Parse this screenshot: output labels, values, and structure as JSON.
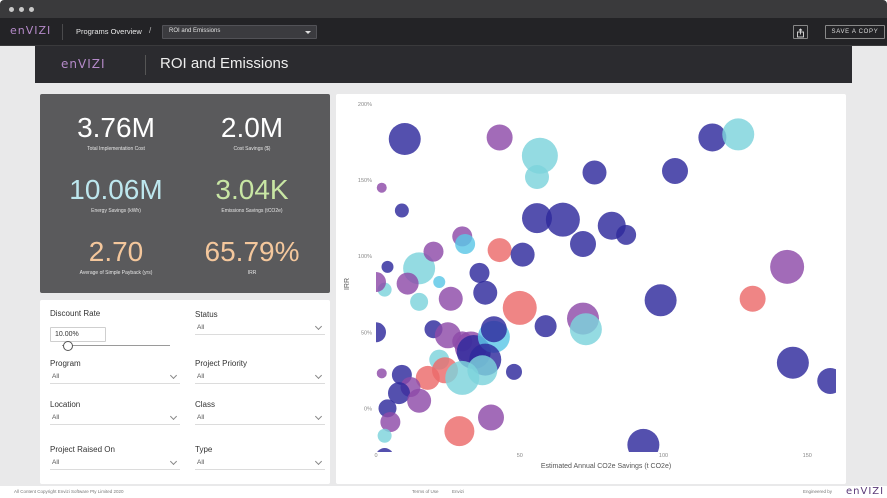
{
  "window": {
    "dots": [
      "",
      "",
      ""
    ]
  },
  "appbar": {
    "logo": "enVIZI",
    "breadcrumb": "Programs Overview",
    "breadcrumb_separator": "/",
    "report_select": "ROI and Emissions",
    "share_icon": "share-icon",
    "save_copy_label": "SAVE A COPY"
  },
  "hero": {
    "logo": "enVIZI",
    "title": "ROI and Emissions"
  },
  "kpis": [
    {
      "value": "3.76M",
      "label": "Total Implementation Cost",
      "color": "#ffffff"
    },
    {
      "value": "2.0M",
      "label": "Cost Savings ($)",
      "color": "#ffffff"
    },
    {
      "value": "10.06M",
      "label": "Energy Savings (kWh)",
      "color": "#bde7ee"
    },
    {
      "value": "3.04K",
      "label": "Emissions Savings (tCO2e)",
      "color": "#c8e6a4"
    },
    {
      "value": "2.70",
      "label": "Average of Simple Payback (yrs)",
      "color": "#f4c79c"
    },
    {
      "value": "65.79%",
      "label": "IRR",
      "color": "#f4c79c"
    }
  ],
  "filters": {
    "discount_rate": {
      "label": "Discount Rate",
      "value": "10.00%",
      "slider_fraction": 0.05
    },
    "status": {
      "label": "Status",
      "value": "All"
    },
    "program": {
      "label": "Program",
      "value": "All"
    },
    "project_priority": {
      "label": "Project Priority",
      "value": "All"
    },
    "location": {
      "label": "Location",
      "value": "All"
    },
    "class": {
      "label": "Class",
      "value": "All"
    },
    "project_raised_on": {
      "label": "Project Raised On",
      "value": "All"
    },
    "type": {
      "label": "Type",
      "value": "All"
    }
  },
  "chart_data": {
    "type": "scatter",
    "title": "",
    "xlabel": "Estimated Annual CO2e Savings (t CO2e)",
    "ylabel": "IRR",
    "xlim": [
      0,
      160
    ],
    "ylim": [
      -30,
      200
    ],
    "x_ticks": [
      0,
      50,
      100,
      150
    ],
    "x_tick_labels": [
      "0",
      "50",
      "100",
      "150"
    ],
    "y_ticks": [
      0,
      50,
      100,
      150,
      200
    ],
    "y_tick_labels": [
      "0%",
      "50%",
      "100%",
      "150%",
      "200%"
    ],
    "grid": false,
    "legend": "none",
    "colors": {
      "navy": "#2e2a9c",
      "purple": "#8e4aa8",
      "cyan": "#7dd3dc",
      "salmon": "#ec6a6a",
      "sky": "#5bc7e6"
    },
    "points": [
      {
        "x": 10,
        "y": 177,
        "size": 16,
        "color": "navy"
      },
      {
        "x": 43,
        "y": 178,
        "size": 13,
        "color": "purple"
      },
      {
        "x": 2,
        "y": 145,
        "size": 5,
        "color": "purple"
      },
      {
        "x": 9,
        "y": 130,
        "size": 7,
        "color": "navy"
      },
      {
        "x": 57,
        "y": 166,
        "size": 18,
        "color": "cyan"
      },
      {
        "x": 56,
        "y": 152,
        "size": 12,
        "color": "cyan"
      },
      {
        "x": 76,
        "y": 155,
        "size": 12,
        "color": "navy"
      },
      {
        "x": 104,
        "y": 156,
        "size": 13,
        "color": "navy"
      },
      {
        "x": 117,
        "y": 178,
        "size": 14,
        "color": "navy"
      },
      {
        "x": 126,
        "y": 180,
        "size": 16,
        "color": "cyan"
      },
      {
        "x": 56,
        "y": 125,
        "size": 15,
        "color": "navy"
      },
      {
        "x": 65,
        "y": 124,
        "size": 17,
        "color": "navy"
      },
      {
        "x": 82,
        "y": 120,
        "size": 14,
        "color": "navy"
      },
      {
        "x": 72,
        "y": 108,
        "size": 13,
        "color": "navy"
      },
      {
        "x": 87,
        "y": 114,
        "size": 10,
        "color": "navy"
      },
      {
        "x": 15,
        "y": 92,
        "size": 16,
        "color": "cyan"
      },
      {
        "x": 4,
        "y": 93,
        "size": 6,
        "color": "navy"
      },
      {
        "x": 20,
        "y": 103,
        "size": 10,
        "color": "purple"
      },
      {
        "x": 30,
        "y": 113,
        "size": 10,
        "color": "purple"
      },
      {
        "x": 31,
        "y": 108,
        "size": 10,
        "color": "sky"
      },
      {
        "x": 43,
        "y": 104,
        "size": 12,
        "color": "salmon"
      },
      {
        "x": 51,
        "y": 101,
        "size": 12,
        "color": "navy"
      },
      {
        "x": 36,
        "y": 89,
        "size": 10,
        "color": "navy"
      },
      {
        "x": 11,
        "y": 82,
        "size": 11,
        "color": "purple"
      },
      {
        "x": 22,
        "y": 83,
        "size": 6,
        "color": "sky"
      },
      {
        "x": 3,
        "y": 78,
        "size": 7,
        "color": "cyan"
      },
      {
        "x": 0,
        "y": 83,
        "size": 10,
        "color": "purple"
      },
      {
        "x": 15,
        "y": 70,
        "size": 9,
        "color": "cyan"
      },
      {
        "x": 26,
        "y": 72,
        "size": 12,
        "color": "purple"
      },
      {
        "x": 38,
        "y": 76,
        "size": 12,
        "color": "navy"
      },
      {
        "x": 50,
        "y": 66,
        "size": 17,
        "color": "salmon"
      },
      {
        "x": 72,
        "y": 59,
        "size": 16,
        "color": "purple"
      },
      {
        "x": 73,
        "y": 52,
        "size": 16,
        "color": "cyan"
      },
      {
        "x": 59,
        "y": 54,
        "size": 11,
        "color": "navy"
      },
      {
        "x": 99,
        "y": 71,
        "size": 16,
        "color": "navy"
      },
      {
        "x": 131,
        "y": 72,
        "size": 13,
        "color": "salmon"
      },
      {
        "x": 143,
        "y": 93,
        "size": 17,
        "color": "purple"
      },
      {
        "x": 0,
        "y": 50,
        "size": 10,
        "color": "navy"
      },
      {
        "x": 20,
        "y": 52,
        "size": 9,
        "color": "navy"
      },
      {
        "x": 25,
        "y": 48,
        "size": 13,
        "color": "purple"
      },
      {
        "x": 30,
        "y": 44,
        "size": 10,
        "color": "purple"
      },
      {
        "x": 33,
        "y": 40,
        "size": 16,
        "color": "purple"
      },
      {
        "x": 34,
        "y": 37,
        "size": 17,
        "color": "navy"
      },
      {
        "x": 41,
        "y": 47,
        "size": 16,
        "color": "sky"
      },
      {
        "x": 41,
        "y": 52,
        "size": 13,
        "color": "navy"
      },
      {
        "x": 38,
        "y": 32,
        "size": 16,
        "color": "navy"
      },
      {
        "x": 22,
        "y": 32,
        "size": 10,
        "color": "cyan"
      },
      {
        "x": 24,
        "y": 25,
        "size": 13,
        "color": "salmon"
      },
      {
        "x": 18,
        "y": 20,
        "size": 12,
        "color": "salmon"
      },
      {
        "x": 30,
        "y": 20,
        "size": 17,
        "color": "cyan"
      },
      {
        "x": 37,
        "y": 25,
        "size": 15,
        "color": "cyan"
      },
      {
        "x": 48,
        "y": 24,
        "size": 8,
        "color": "navy"
      },
      {
        "x": 9,
        "y": 22,
        "size": 10,
        "color": "navy"
      },
      {
        "x": 2,
        "y": 23,
        "size": 5,
        "color": "purple"
      },
      {
        "x": 12,
        "y": 14,
        "size": 10,
        "color": "purple"
      },
      {
        "x": 8,
        "y": 10,
        "size": 11,
        "color": "navy"
      },
      {
        "x": 15,
        "y": 5,
        "size": 12,
        "color": "purple"
      },
      {
        "x": 4,
        "y": 0,
        "size": 9,
        "color": "navy"
      },
      {
        "x": 5,
        "y": -9,
        "size": 10,
        "color": "purple"
      },
      {
        "x": 40,
        "y": -6,
        "size": 13,
        "color": "purple"
      },
      {
        "x": 29,
        "y": -15,
        "size": 15,
        "color": "salmon"
      },
      {
        "x": 3,
        "y": -18,
        "size": 7,
        "color": "cyan"
      },
      {
        "x": 3,
        "y": -32,
        "size": 9,
        "color": "navy"
      },
      {
        "x": 93,
        "y": -24,
        "size": 16,
        "color": "navy"
      },
      {
        "x": 145,
        "y": 30,
        "size": 16,
        "color": "navy"
      },
      {
        "x": 158,
        "y": 18,
        "size": 13,
        "color": "navy"
      }
    ]
  },
  "footer": {
    "copyright": "All Content Copyright Envizi Software Pty Limited 2020",
    "terms": "Terms of Use",
    "envizi_link": "Envizi",
    "engineered_by": "Engineered by",
    "logo": "enVIZI"
  }
}
